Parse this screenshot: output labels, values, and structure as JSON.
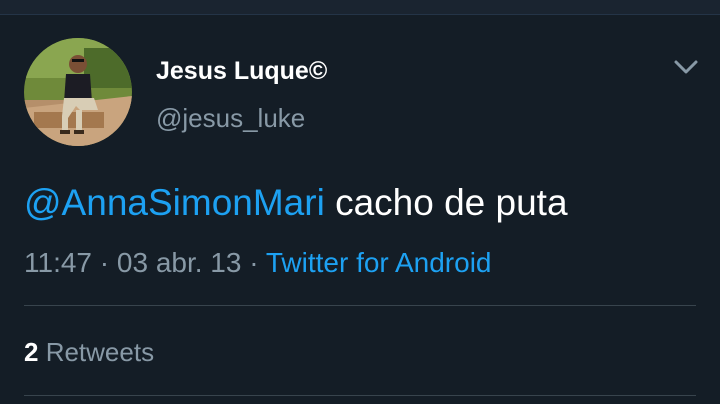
{
  "tweet": {
    "user": {
      "display_name": "Jesus Luque©",
      "handle": "@jesus_luke",
      "avatar_icon": "profile-photo"
    },
    "mention": "@AnnaSimonMari",
    "text": " cacho de puta",
    "time": "11:47",
    "separator": " · ",
    "date": "03 abr. 13",
    "source": "Twitter for Android",
    "menu_icon": "chevron-down-icon"
  },
  "stats": {
    "retweets_count": "2",
    "retweets_label": " Retweets"
  },
  "colors": {
    "background": "#141d26",
    "link": "#1da1f2",
    "secondary_text": "#8899a6",
    "divider": "#38444d"
  }
}
